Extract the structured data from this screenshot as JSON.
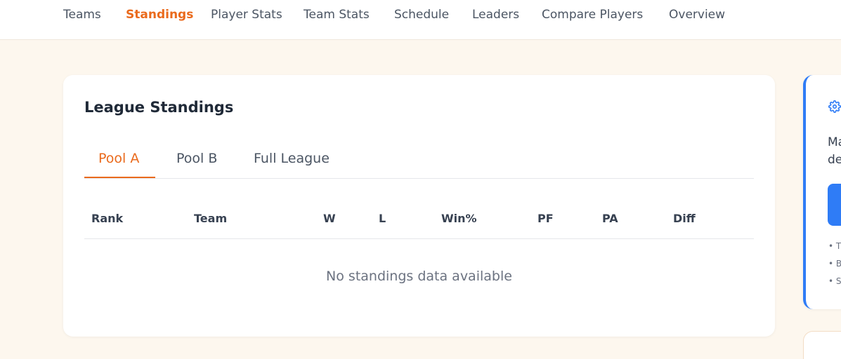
{
  "nav": {
    "items": [
      {
        "label": "Teams"
      },
      {
        "label": "Standings"
      },
      {
        "label": "Player Stats"
      },
      {
        "label": "Team Stats"
      },
      {
        "label": "Schedule"
      },
      {
        "label": "Leaders"
      },
      {
        "label": "Compare Players"
      },
      {
        "label": "Overview"
      }
    ],
    "active": "Standings"
  },
  "standings": {
    "title": "League Standings",
    "tabs": [
      {
        "label": "Pool A"
      },
      {
        "label": "Pool B"
      },
      {
        "label": "Full League"
      }
    ],
    "active_tab": "Pool A",
    "columns": [
      "Rank",
      "Team",
      "W",
      "L",
      "Win%",
      "PF",
      "PA",
      "Diff"
    ],
    "empty_message": "No standings data available"
  },
  "side_panel": {
    "line1": "Ma",
    "line2": "de",
    "bullets": [
      "• T",
      "• B",
      "• S"
    ],
    "icon": "gear-icon"
  },
  "colors": {
    "accent": "#ea6a1c",
    "side_accent": "#2f7cf6",
    "background": "#fdf7ee"
  }
}
